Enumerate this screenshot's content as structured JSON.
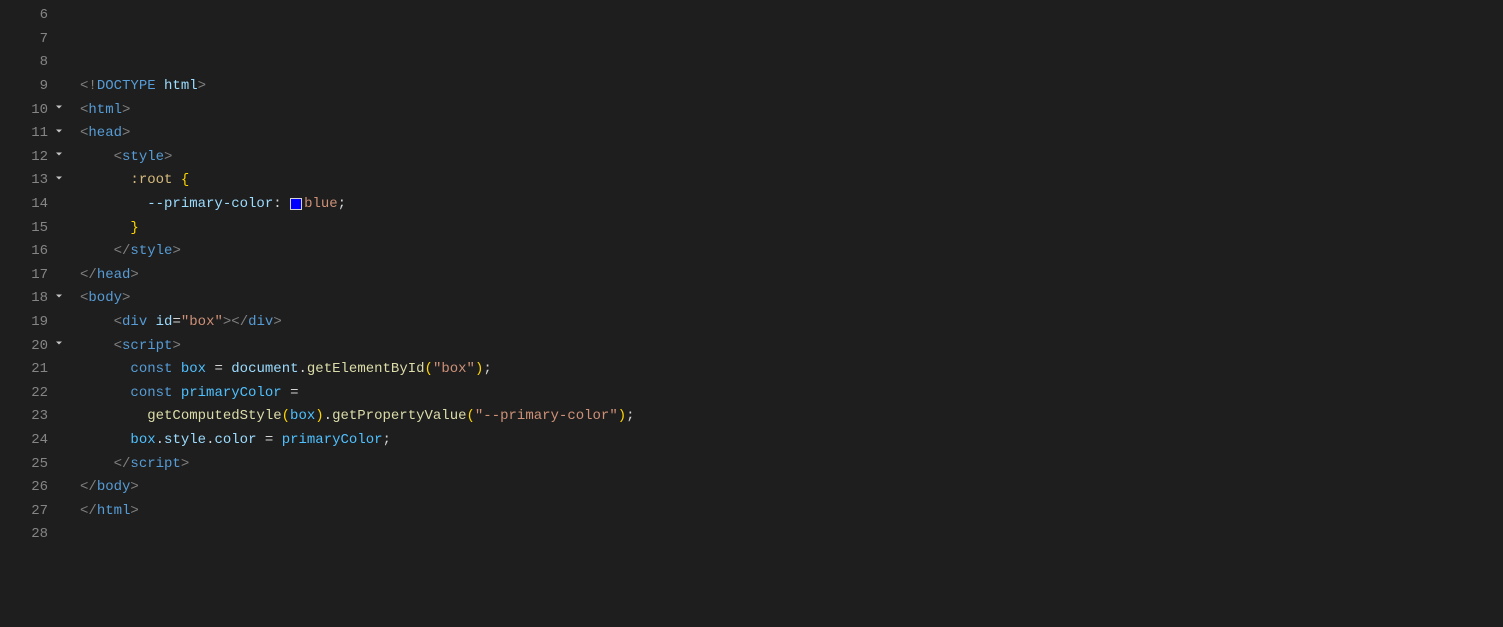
{
  "lines": [
    {
      "num": "6",
      "fold": ""
    },
    {
      "num": "7",
      "fold": ""
    },
    {
      "num": "8",
      "fold": ""
    },
    {
      "num": "9",
      "fold": ""
    },
    {
      "num": "10",
      "fold": "chevron"
    },
    {
      "num": "11",
      "fold": "chevron"
    },
    {
      "num": "12",
      "fold": "chevron"
    },
    {
      "num": "13",
      "fold": "chevron"
    },
    {
      "num": "14",
      "fold": ""
    },
    {
      "num": "15",
      "fold": ""
    },
    {
      "num": "16",
      "fold": ""
    },
    {
      "num": "17",
      "fold": ""
    },
    {
      "num": "18",
      "fold": "chevron"
    },
    {
      "num": "19",
      "fold": ""
    },
    {
      "num": "20",
      "fold": "chevron"
    },
    {
      "num": "21",
      "fold": ""
    },
    {
      "num": "22",
      "fold": ""
    },
    {
      "num": "23",
      "fold": ""
    },
    {
      "num": "24",
      "fold": ""
    },
    {
      "num": "25",
      "fold": ""
    },
    {
      "num": "26",
      "fold": ""
    },
    {
      "num": "27",
      "fold": ""
    },
    {
      "num": "28",
      "fold": ""
    }
  ],
  "tokens": {
    "lt": "<",
    "gt": ">",
    "excl": "!",
    "slash": "/",
    "eq": "=",
    "lparen": "(",
    "rparen": ")",
    "lbrace": "{",
    "rbrace": "}",
    "semi": ";",
    "colon": ":",
    "dot": ".",
    "sp1": " ",
    "sp4": "    ",
    "sp6": "      ",
    "sp8": "        ",
    "sp10": "          ",
    "doctype": "DOCTYPE",
    "html": "html",
    "head": "head",
    "style": "style",
    "body": "body",
    "div": "div",
    "script": "script",
    "root": ":root",
    "primarycolor_prop": "--primary-color",
    "blue": "blue",
    "id_attr": "id",
    "box_str": "\"box\"",
    "const": "const",
    "box_var": "box",
    "document": "document",
    "getElementById": "getElementById",
    "primaryColor_var": "primaryColor",
    "getComputedStyle": "getComputedStyle",
    "getPropertyValue": "getPropertyValue",
    "primarycolor_str": "\"--primary-color\"",
    "style_prop": "style",
    "color_prop": "color"
  },
  "colors": {
    "swatch": "#0000ff"
  }
}
